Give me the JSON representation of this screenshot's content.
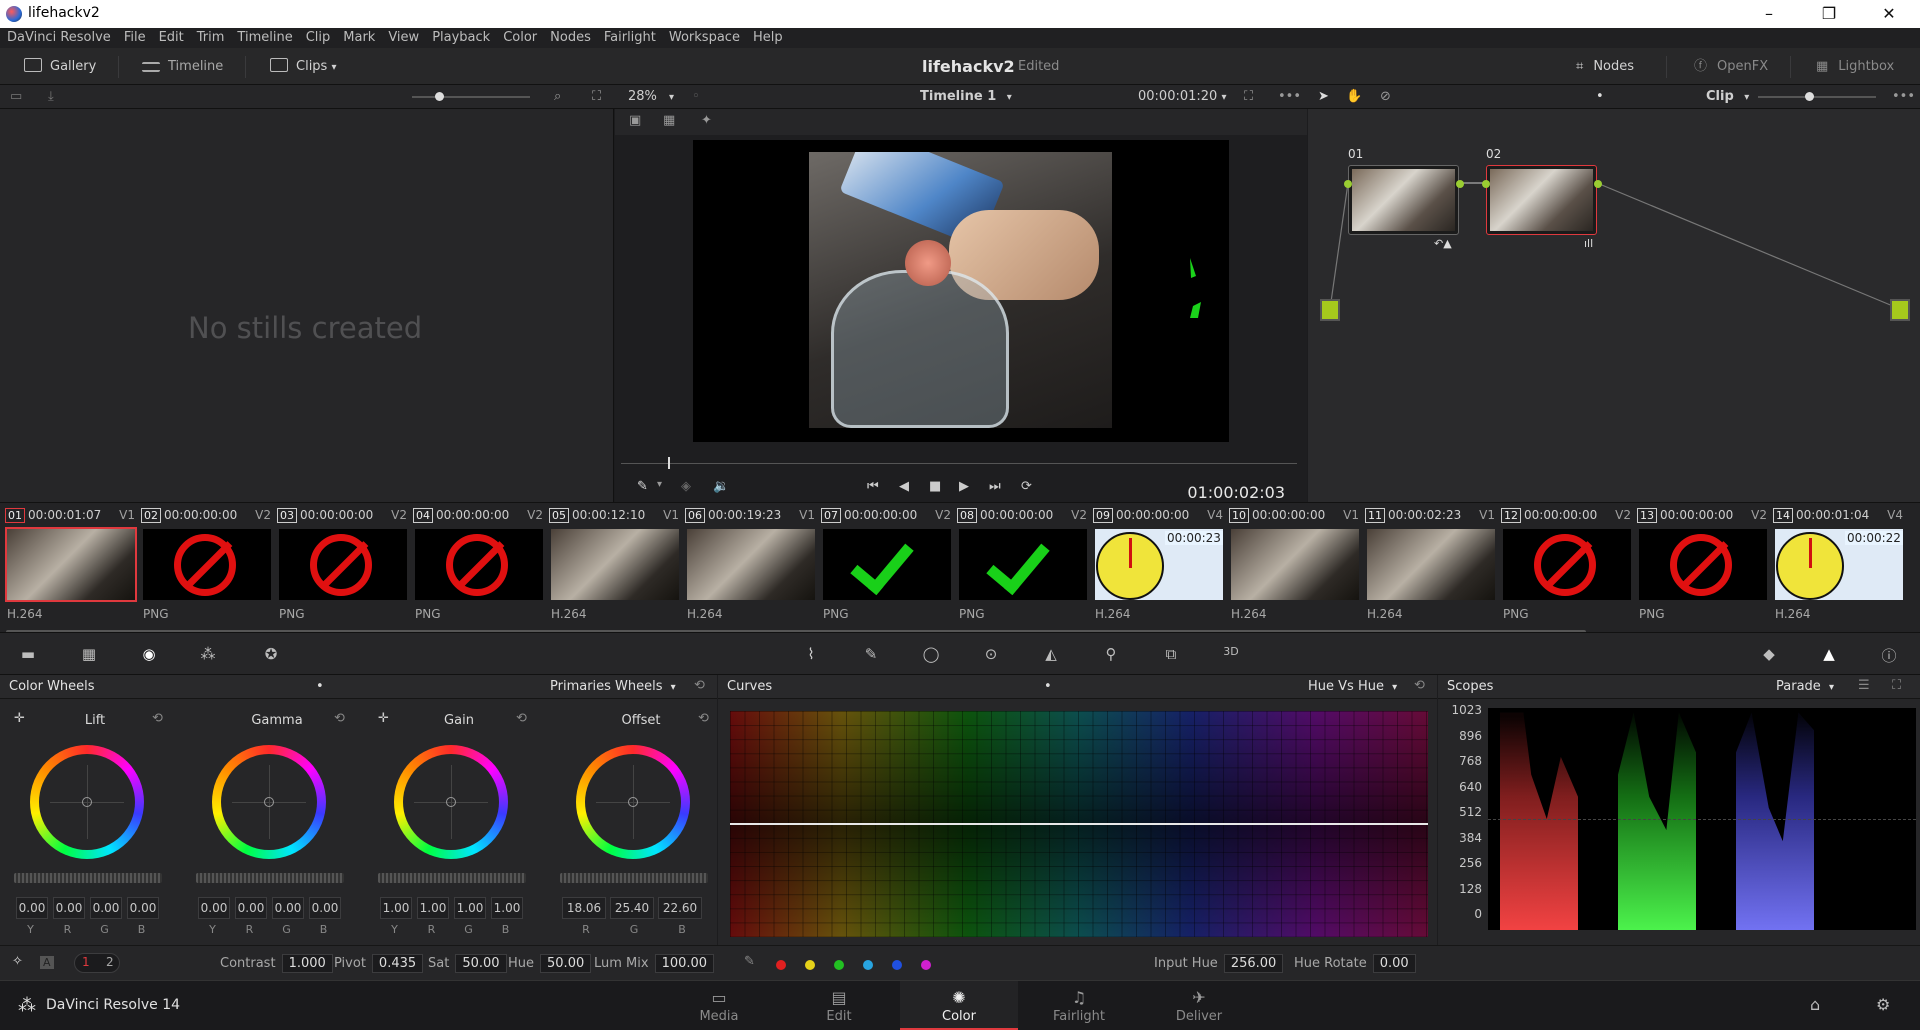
{
  "window": {
    "title": "lifehackv2"
  },
  "menu": [
    "DaVinci Resolve",
    "File",
    "Edit",
    "Trim",
    "Timeline",
    "Clip",
    "Mark",
    "View",
    "Playback",
    "Color",
    "Nodes",
    "Fairlight",
    "Workspace",
    "Help"
  ],
  "toolbar": {
    "gallery": "Gallery",
    "timeline": "Timeline",
    "clips": "Clips",
    "project_title": "lifehackv2",
    "status": "Edited",
    "nodes": "Nodes",
    "openfx": "OpenFX",
    "lightbox": "Lightbox"
  },
  "viewer": {
    "zoom": "28%",
    "timeline_name": "Timeline 1",
    "timecode": "00:00:01:20",
    "playhead_tc": "01:00:02:03",
    "node_mode": "Clip"
  },
  "gallery": {
    "empty_text": "No stills created"
  },
  "node_editor": {
    "node1": "01",
    "node2": "02"
  },
  "clips": [
    {
      "num": "01",
      "tc": "00:00:01:07",
      "track": "V1",
      "fmt": "H.264",
      "thumb": "video",
      "active": true
    },
    {
      "num": "02",
      "tc": "00:00:00:00",
      "track": "V2",
      "fmt": "PNG",
      "thumb": "noentry"
    },
    {
      "num": "03",
      "tc": "00:00:00:00",
      "track": "V2",
      "fmt": "PNG",
      "thumb": "noentry"
    },
    {
      "num": "04",
      "tc": "00:00:00:00",
      "track": "V2",
      "fmt": "PNG",
      "thumb": "noentry"
    },
    {
      "num": "05",
      "tc": "00:00:12:10",
      "track": "V1",
      "fmt": "H.264",
      "thumb": "video"
    },
    {
      "num": "06",
      "tc": "00:00:19:23",
      "track": "V1",
      "fmt": "H.264",
      "thumb": "video"
    },
    {
      "num": "07",
      "tc": "00:00:00:00",
      "track": "V2",
      "fmt": "PNG",
      "thumb": "check"
    },
    {
      "num": "08",
      "tc": "00:00:00:00",
      "track": "V2",
      "fmt": "PNG",
      "thumb": "check"
    },
    {
      "num": "09",
      "tc": "00:00:00:00",
      "track": "V4",
      "fmt": "H.264",
      "thumb": "timer",
      "timer": "00:00:23"
    },
    {
      "num": "10",
      "tc": "00:00:00:00",
      "track": "V1",
      "fmt": "H.264",
      "thumb": "video"
    },
    {
      "num": "11",
      "tc": "00:00:02:23",
      "track": "V1",
      "fmt": "H.264",
      "thumb": "video"
    },
    {
      "num": "12",
      "tc": "00:00:00:00",
      "track": "V2",
      "fmt": "PNG",
      "thumb": "noentry"
    },
    {
      "num": "13",
      "tc": "00:00:00:00",
      "track": "V2",
      "fmt": "PNG",
      "thumb": "noentry"
    },
    {
      "num": "14",
      "tc": "00:00:01:04",
      "track": "V4",
      "fmt": "H.264",
      "thumb": "timer",
      "timer": "00:00:22"
    }
  ],
  "color_wheels": {
    "title": "Color Wheels",
    "mode": "Primaries Wheels",
    "wheels": [
      {
        "name": "Lift",
        "values": [
          "0.00",
          "0.00",
          "0.00",
          "0.00"
        ],
        "labels": [
          "Y",
          "R",
          "G",
          "B"
        ]
      },
      {
        "name": "Gamma",
        "values": [
          "0.00",
          "0.00",
          "0.00",
          "0.00"
        ],
        "labels": [
          "Y",
          "R",
          "G",
          "B"
        ]
      },
      {
        "name": "Gain",
        "values": [
          "1.00",
          "1.00",
          "1.00",
          "1.00"
        ],
        "labels": [
          "Y",
          "R",
          "G",
          "B"
        ]
      },
      {
        "name": "Offset",
        "values": [
          "18.06",
          "25.40",
          "22.60"
        ],
        "labels": [
          "R",
          "G",
          "B"
        ]
      }
    ]
  },
  "curves": {
    "title": "Curves",
    "mode": "Hue Vs Hue",
    "input_hue_label": "Input Hue",
    "input_hue": "256.00",
    "hue_rotate_label": "Hue Rotate",
    "hue_rotate": "0.00"
  },
  "scopes": {
    "title": "Scopes",
    "mode": "Parade",
    "ticks": [
      "1023",
      "896",
      "768",
      "640",
      "512",
      "384",
      "256",
      "128",
      "0"
    ]
  },
  "controls": {
    "page1": "1",
    "page2": "2",
    "contrast_label": "Contrast",
    "contrast": "1.000",
    "pivot_label": "Pivot",
    "pivot": "0.435",
    "sat_label": "Sat",
    "sat": "50.00",
    "hue_label": "Hue",
    "hue": "50.00",
    "lummix_label": "Lum Mix",
    "lummix": "100.00"
  },
  "pages": [
    "Media",
    "Edit",
    "Color",
    "Fairlight",
    "Deliver"
  ],
  "brand": "DaVinci Resolve 14",
  "colors": {
    "accent": "#e0393e",
    "node_point": "#9acd32"
  }
}
